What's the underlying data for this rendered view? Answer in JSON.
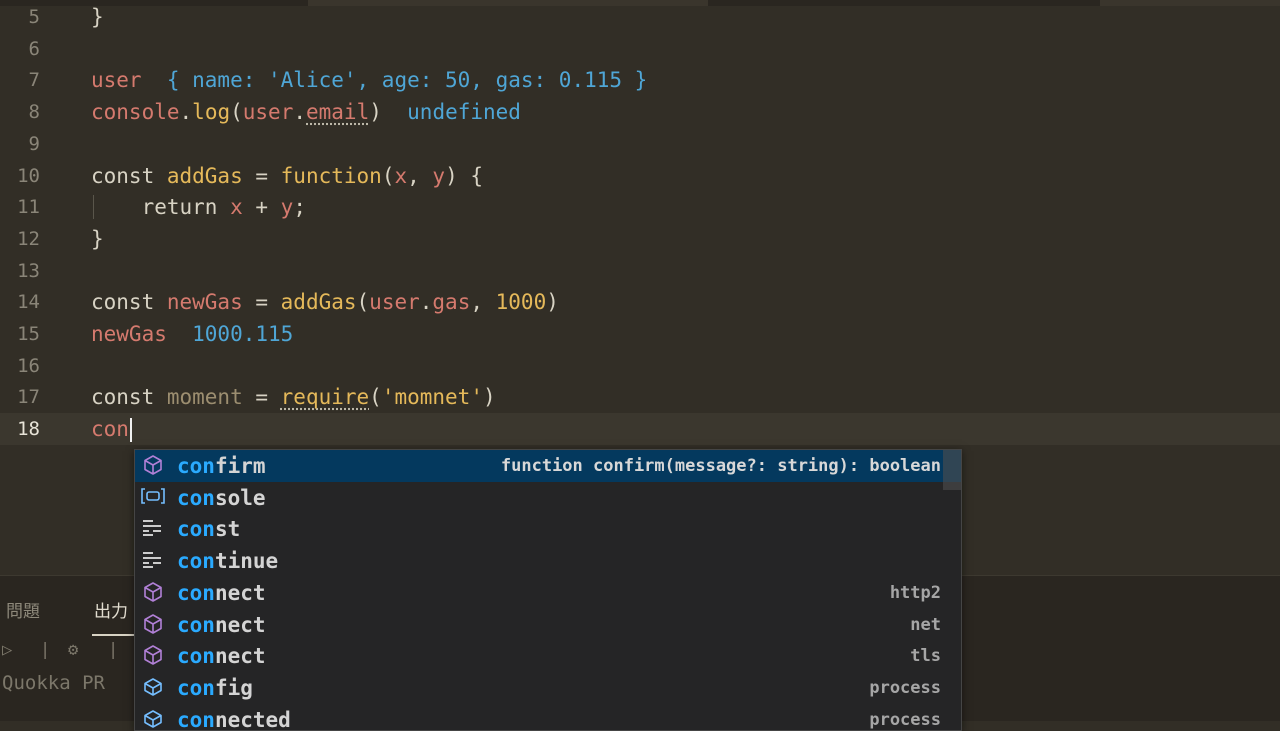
{
  "editor": {
    "lines": [
      {
        "num": "5",
        "tokens": [
          {
            "t": "}",
            "c": "punc"
          }
        ]
      },
      {
        "num": "6",
        "tokens": []
      },
      {
        "num": "7",
        "tokens": [
          {
            "t": "user",
            "c": "var"
          },
          {
            "t": "  { name: 'Alice', age: 50, gas: 0.115 }",
            "c": "quokka"
          }
        ]
      },
      {
        "num": "8",
        "tokens": [
          {
            "t": "console",
            "c": "param"
          },
          {
            "t": ".",
            "c": "punc"
          },
          {
            "t": "log",
            "c": "fn"
          },
          {
            "t": "(",
            "c": "punc"
          },
          {
            "t": "user",
            "c": "param"
          },
          {
            "t": ".",
            "c": "punc"
          },
          {
            "t": "email",
            "c": "param squiggle"
          },
          {
            "t": ")",
            "c": "punc"
          },
          {
            "t": "  undefined",
            "c": "quokka"
          }
        ]
      },
      {
        "num": "9",
        "tokens": []
      },
      {
        "num": "10",
        "tokens": [
          {
            "t": "const ",
            "c": "kw"
          },
          {
            "t": "addGas",
            "c": "fn"
          },
          {
            "t": " = ",
            "c": "punc"
          },
          {
            "t": "function",
            "c": "fn"
          },
          {
            "t": "(",
            "c": "punc"
          },
          {
            "t": "x",
            "c": "param"
          },
          {
            "t": ", ",
            "c": "punc"
          },
          {
            "t": "y",
            "c": "param"
          },
          {
            "t": ") {",
            "c": "punc"
          }
        ]
      },
      {
        "num": "11",
        "guide": true,
        "tokens": [
          {
            "t": "    return ",
            "c": "kw"
          },
          {
            "t": "x",
            "c": "param"
          },
          {
            "t": " + ",
            "c": "punc"
          },
          {
            "t": "y",
            "c": "param"
          },
          {
            "t": ";",
            "c": "punc"
          }
        ]
      },
      {
        "num": "12",
        "tokens": [
          {
            "t": "}",
            "c": "punc"
          }
        ]
      },
      {
        "num": "13",
        "tokens": []
      },
      {
        "num": "14",
        "tokens": [
          {
            "t": "const ",
            "c": "kw"
          },
          {
            "t": "newGas",
            "c": "var"
          },
          {
            "t": " = ",
            "c": "punc"
          },
          {
            "t": "addGas",
            "c": "fn"
          },
          {
            "t": "(",
            "c": "punc"
          },
          {
            "t": "user",
            "c": "param"
          },
          {
            "t": ".",
            "c": "punc"
          },
          {
            "t": "gas",
            "c": "param"
          },
          {
            "t": ", ",
            "c": "punc"
          },
          {
            "t": "1000",
            "c": "num"
          },
          {
            "t": ")",
            "c": "punc"
          }
        ]
      },
      {
        "num": "15",
        "tokens": [
          {
            "t": "newGas",
            "c": "var"
          },
          {
            "t": "  1000.115",
            "c": "quokka"
          }
        ]
      },
      {
        "num": "16",
        "tokens": []
      },
      {
        "num": "17",
        "tokens": [
          {
            "t": "const ",
            "c": "kw"
          },
          {
            "t": "moment",
            "c": "param dim"
          },
          {
            "t": " = ",
            "c": "punc"
          },
          {
            "t": "require",
            "c": "fn squiggle"
          },
          {
            "t": "(",
            "c": "punc"
          },
          {
            "t": "'momnet'",
            "c": "str"
          },
          {
            "t": ")",
            "c": "punc"
          }
        ]
      },
      {
        "num": "18",
        "current": true,
        "cursor": true,
        "tokens": [
          {
            "t": "con",
            "c": "param"
          }
        ]
      }
    ]
  },
  "suggest": {
    "items": [
      {
        "icon": "method-icon",
        "match": "con",
        "rest": "firm",
        "detail": "function confirm(message?: string): boolean",
        "selected": true
      },
      {
        "icon": "variable-icon",
        "match": "con",
        "rest": "sole",
        "detail": ""
      },
      {
        "icon": "keyword-icon",
        "match": "con",
        "rest": "st",
        "detail": ""
      },
      {
        "icon": "keyword-icon",
        "match": "con",
        "rest": "tinue",
        "detail": ""
      },
      {
        "icon": "method-icon",
        "match": "con",
        "rest": "nect",
        "detail": "http2"
      },
      {
        "icon": "method-icon",
        "match": "con",
        "rest": "nect",
        "detail": "net"
      },
      {
        "icon": "method-icon",
        "match": "con",
        "rest": "nect",
        "detail": "tls"
      },
      {
        "icon": "field-icon",
        "match": "con",
        "rest": "fig",
        "detail": "process"
      },
      {
        "icon": "field-icon",
        "match": "con",
        "rest": "nected",
        "detail": "process"
      }
    ]
  },
  "panel": {
    "tab_problems": "問題",
    "tab_output": "出力",
    "output_prefix": "Quokka PR"
  },
  "colors": {
    "accent": "#04395e",
    "match_highlight": "#2aaaff",
    "method_icon": "#b180d7",
    "field_icon": "#75beff"
  }
}
